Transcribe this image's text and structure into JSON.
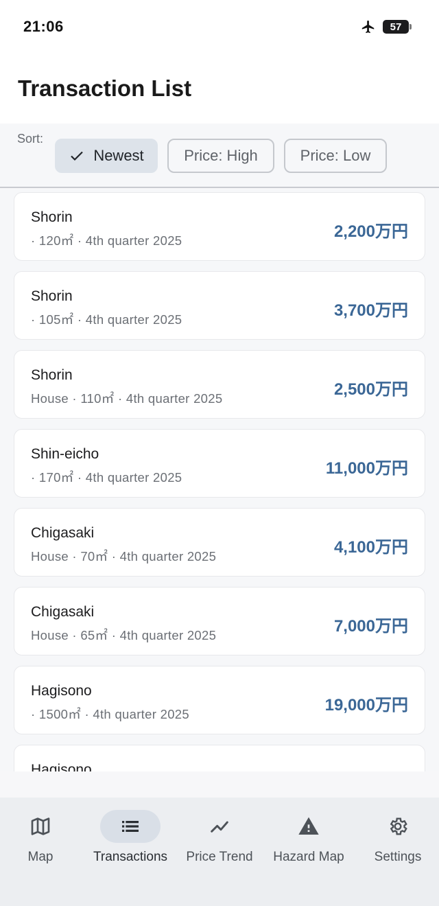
{
  "status_bar": {
    "time": "21:06",
    "battery": "57",
    "icons": [
      "airplane-icon",
      "battery-icon"
    ]
  },
  "header": {
    "title": "Transaction List"
  },
  "sort": {
    "label": "Sort:",
    "options": [
      {
        "label": "Newest",
        "selected": true,
        "icon": "check-icon"
      },
      {
        "label": "Price: High",
        "selected": false
      },
      {
        "label": "Price: Low",
        "selected": false
      }
    ]
  },
  "transactions": [
    {
      "area": "Shorin",
      "details": "· 120㎡ · 4th quarter 2025",
      "price": "2,200万円"
    },
    {
      "area": "Shorin",
      "details": "· 105㎡ · 4th quarter 2025",
      "price": "3,700万円"
    },
    {
      "area": "Shorin",
      "details": "House · 110㎡ · 4th quarter 2025",
      "price": "2,500万円"
    },
    {
      "area": "Shin-eicho",
      "details": "· 170㎡ · 4th quarter 2025",
      "price": "11,000万円"
    },
    {
      "area": "Chigasaki",
      "details": "House · 70㎡ · 4th quarter 2025",
      "price": "4,100万円"
    },
    {
      "area": "Chigasaki",
      "details": "House · 65㎡ · 4th quarter 2025",
      "price": "7,000万円"
    },
    {
      "area": "Hagisono",
      "details": "· 1500㎡ · 4th quarter 2025",
      "price": "19,000万円"
    },
    {
      "area": "Hagisono",
      "details": "",
      "price": ""
    }
  ],
  "colors": {
    "price": "#3b6796",
    "selected_chip": "#dde3ea",
    "nav_background": "#eceef1",
    "active_indicator": "#d9dfe7"
  },
  "bottom_nav": [
    {
      "label": "Map",
      "icon": "map-icon",
      "active": false
    },
    {
      "label": "Transactions",
      "icon": "list-icon",
      "active": true
    },
    {
      "label": "Price Trend",
      "icon": "trend-icon",
      "active": false
    },
    {
      "label": "Hazard Map",
      "icon": "warning-icon",
      "active": false
    },
    {
      "label": "Settings",
      "icon": "gear-icon",
      "active": false
    }
  ]
}
